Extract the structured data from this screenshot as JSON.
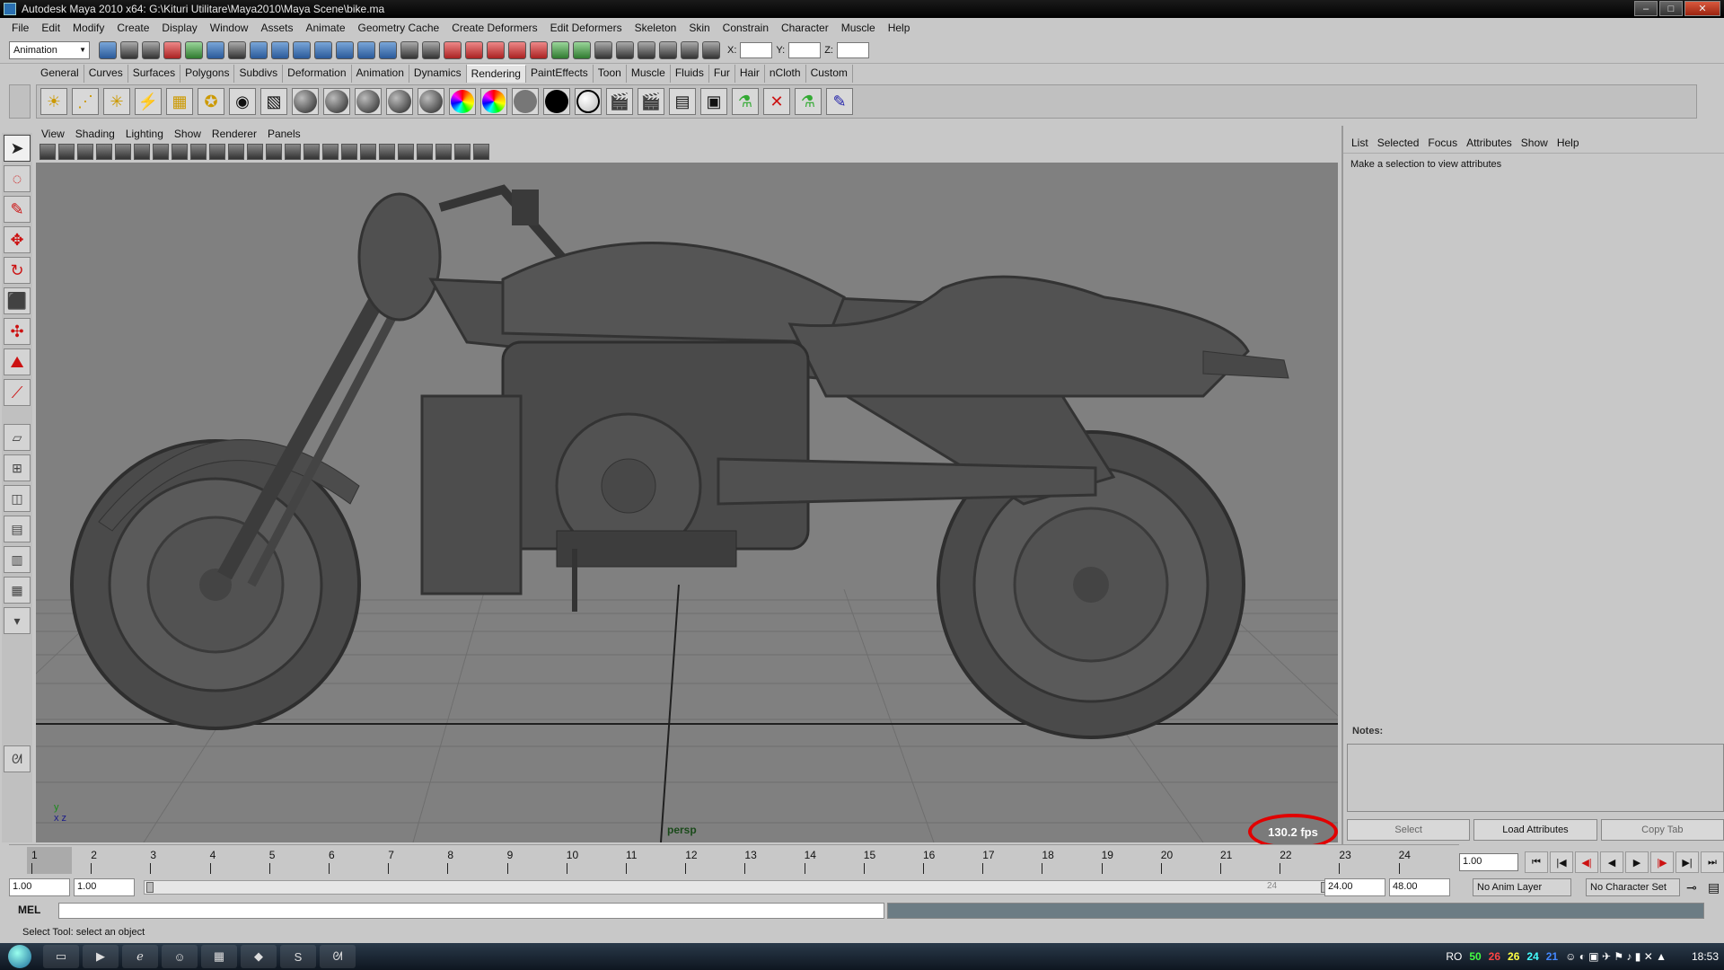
{
  "window": {
    "title": "Autodesk Maya 2010 x64: G:\\Kituri Utilitare\\Maya2010\\Maya Scene\\bike.ma"
  },
  "menubar": [
    "File",
    "Edit",
    "Modify",
    "Create",
    "Display",
    "Window",
    "Assets",
    "Animate",
    "Geometry Cache",
    "Create Deformers",
    "Edit Deformers",
    "Skeleton",
    "Skin",
    "Constrain",
    "Character",
    "Muscle",
    "Help"
  ],
  "statusline": {
    "mode": "Animation",
    "x_label": "X:",
    "y_label": "Y:",
    "z_label": "Z:"
  },
  "shelf_tabs": [
    "General",
    "Curves",
    "Surfaces",
    "Polygons",
    "Subdivs",
    "Deformation",
    "Animation",
    "Dynamics",
    "Rendering",
    "PaintEffects",
    "Toon",
    "Muscle",
    "Fluids",
    "Fur",
    "Hair",
    "nCloth",
    "Custom"
  ],
  "shelf_active": "Rendering",
  "viewport": {
    "menu": [
      "View",
      "Shading",
      "Lighting",
      "Show",
      "Renderer",
      "Panels"
    ],
    "camera": "persp",
    "fps": "130.2 fps",
    "axis_y": "y",
    "axis_xz": "x z"
  },
  "attribute_editor": {
    "menu": [
      "List",
      "Selected",
      "Focus",
      "Attributes",
      "Show",
      "Help"
    ],
    "message": "Make a selection to view attributes",
    "notes_label": "Notes:",
    "buttons": {
      "select": "Select",
      "load": "Load Attributes",
      "copy": "Copy Tab"
    }
  },
  "timeline": {
    "ticks": [
      "1",
      "2",
      "3",
      "4",
      "5",
      "6",
      "7",
      "8",
      "9",
      "10",
      "11",
      "12",
      "13",
      "14",
      "15",
      "16",
      "17",
      "18",
      "19",
      "20",
      "21",
      "22",
      "23",
      "24"
    ],
    "current_frame": "1.00"
  },
  "range": {
    "start": "1.00",
    "min": "1.00",
    "end": "24.00",
    "max": "48.00",
    "anim_layer": "No Anim Layer",
    "character_set": "No Character Set",
    "slider_end_label": "24"
  },
  "commandline": {
    "label": "MEL"
  },
  "helpline": "Select Tool: select an object",
  "taskbar": {
    "lang": "RO",
    "counters": [
      "50",
      "26",
      "26",
      "24",
      "21"
    ],
    "clock": "18:53"
  },
  "colors": {
    "viewport_bg": "#808080",
    "fps_ring": "#e10000",
    "ui_bg": "#c8c8c8"
  }
}
